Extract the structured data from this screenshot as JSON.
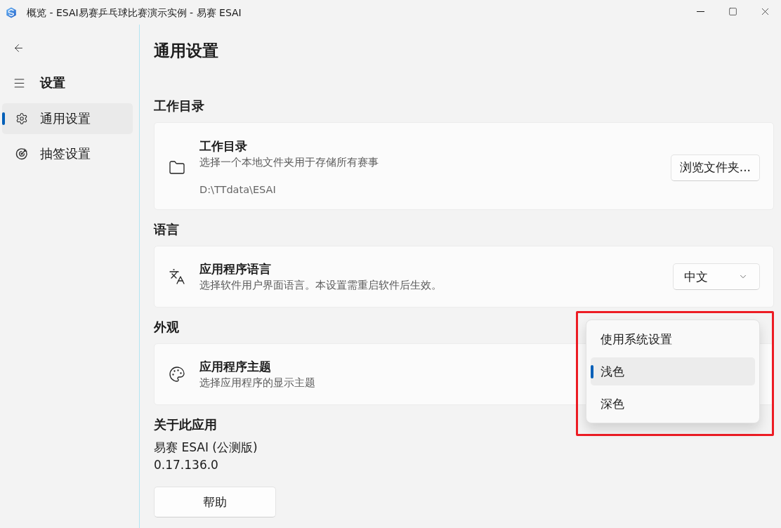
{
  "window": {
    "title": "概览 - ESAI易赛乒乓球比赛演示实例 - 易赛 ESAI"
  },
  "sidebar": {
    "heading": "设置",
    "items": [
      {
        "label": "通用设置",
        "selected": true
      },
      {
        "label": "抽签设置",
        "selected": false
      }
    ]
  },
  "page": {
    "title": "通用设置",
    "sections": [
      {
        "heading": "工作目录",
        "card": {
          "kind": "button",
          "title": "工作目录",
          "description": "选择一个本地文件夹用于存储所有赛事",
          "detail": "D:\\TTdata\\ESAI",
          "button": "浏览文件夹..."
        }
      },
      {
        "heading": "语言",
        "card": {
          "kind": "select",
          "title": "应用程序语言",
          "description": "选择软件用户界面语言。本设置需重启软件后生效。",
          "select": {
            "value": "中文",
            "expanded": false
          }
        }
      },
      {
        "heading": "外观",
        "card": {
          "kind": "select",
          "title": "应用程序主题",
          "description": "选择应用程序的显示主题",
          "select": {
            "expanded": true,
            "options": [
              {
                "label": "使用系统设置",
                "selected": false
              },
              {
                "label": "浅色",
                "selected": true
              },
              {
                "label": "深色",
                "selected": false
              }
            ]
          }
        }
      }
    ]
  },
  "about": {
    "heading": "关于此应用",
    "name": "易赛 ESAI (公测版)",
    "version": "0.17.136.0",
    "button": "帮助"
  }
}
